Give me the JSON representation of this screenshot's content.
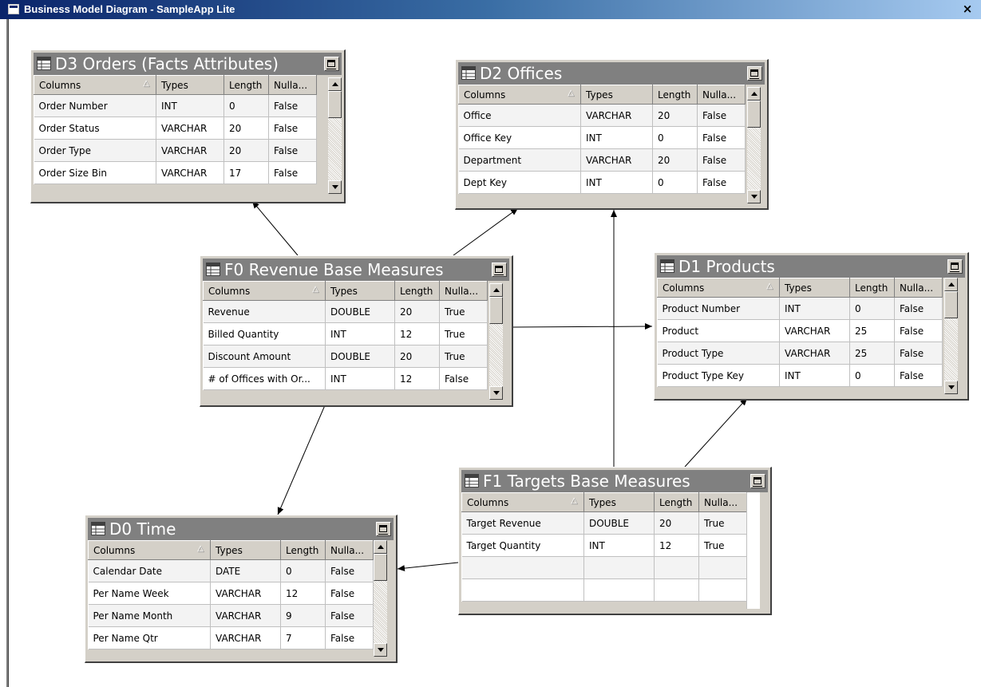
{
  "window": {
    "title": "Business Model Diagram - SampleApp Lite",
    "close_symbol": "×"
  },
  "column_headers": {
    "columns": "Columns",
    "types": "Types",
    "length": "Length",
    "nullable": "Nulla..."
  },
  "tables": {
    "d3": {
      "name": "D3 Orders (Facts Attributes)",
      "rows": [
        [
          "Order Number",
          "INT",
          "0",
          "False"
        ],
        [
          "Order Status",
          "VARCHAR",
          "20",
          "False"
        ],
        [
          "Order Type",
          "VARCHAR",
          "20",
          "False"
        ],
        [
          "Order Size Bin",
          "VARCHAR",
          "17",
          "False"
        ]
      ]
    },
    "d2": {
      "name": "D2 Offices",
      "rows": [
        [
          "Office",
          "VARCHAR",
          "20",
          "False"
        ],
        [
          "Office Key",
          "INT",
          "0",
          "False"
        ],
        [
          "Department",
          "VARCHAR",
          "20",
          "False"
        ],
        [
          "Dept Key",
          "INT",
          "0",
          "False"
        ]
      ]
    },
    "f0": {
      "name": "F0 Revenue Base Measures",
      "rows": [
        [
          "Revenue",
          "DOUBLE",
          "20",
          "True"
        ],
        [
          "Billed Quantity",
          "INT",
          "12",
          "True"
        ],
        [
          "Discount Amount",
          "DOUBLE",
          "20",
          "True"
        ],
        [
          "# of Offices with Or...",
          "INT",
          "12",
          "False"
        ]
      ]
    },
    "d1": {
      "name": "D1 Products",
      "rows": [
        [
          "Product Number",
          "INT",
          "0",
          "False"
        ],
        [
          "Product",
          "VARCHAR",
          "25",
          "False"
        ],
        [
          "Product Type",
          "VARCHAR",
          "25",
          "False"
        ],
        [
          "Product Type Key",
          "INT",
          "0",
          "False"
        ]
      ]
    },
    "f1": {
      "name": "F1 Targets Base Measures",
      "rows": [
        [
          "Target Revenue",
          "DOUBLE",
          "20",
          "True"
        ],
        [
          "Target Quantity",
          "INT",
          "12",
          "True"
        ],
        [
          "",
          "",
          "",
          ""
        ],
        [
          "",
          "",
          "",
          ""
        ]
      ]
    },
    "d0": {
      "name": "D0 Time",
      "rows": [
        [
          "Calendar Date",
          "DATE",
          "0",
          "False"
        ],
        [
          "Per Name Week",
          "VARCHAR",
          "12",
          "False"
        ],
        [
          "Per Name Month",
          "VARCHAR",
          "9",
          "False"
        ],
        [
          "Per Name Qtr",
          "VARCHAR",
          "7",
          "False"
        ]
      ]
    }
  },
  "links": [
    {
      "from": "f0",
      "to": "d3"
    },
    {
      "from": "f0",
      "to": "d2"
    },
    {
      "from": "f0",
      "to": "d1"
    },
    {
      "from": "f0",
      "to": "d0"
    },
    {
      "from": "f1",
      "to": "d2"
    },
    {
      "from": "f1",
      "to": "d1"
    },
    {
      "from": "f1",
      "to": "d0"
    }
  ]
}
